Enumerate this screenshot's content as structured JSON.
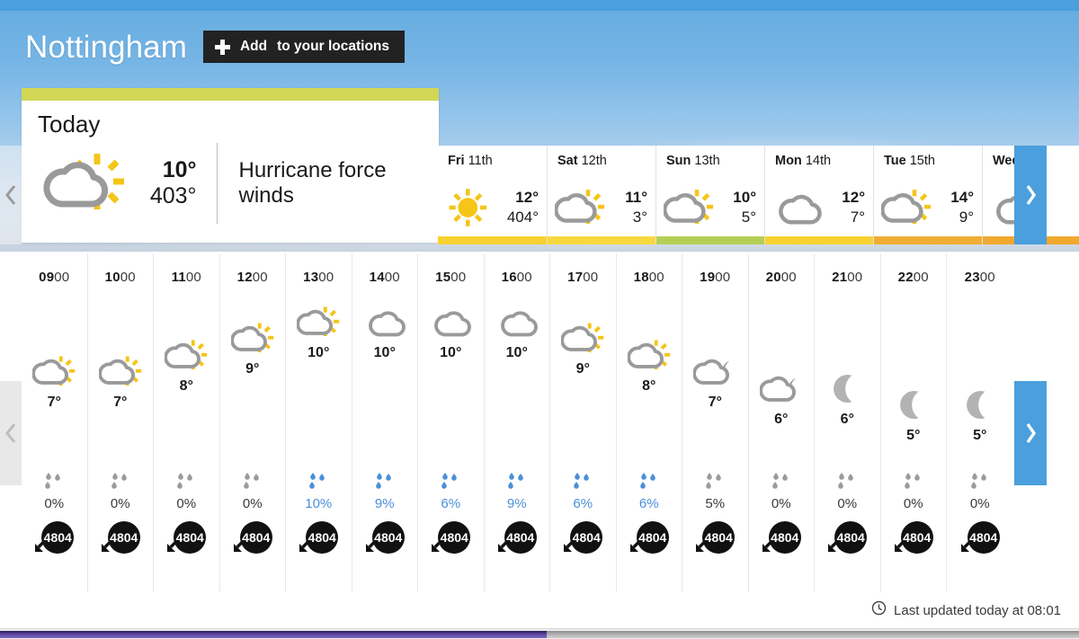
{
  "header": {
    "location": "Nottingham",
    "add_button": {
      "bold": "Add",
      "rest": "to your locations",
      "icon": "plus-icon"
    }
  },
  "today": {
    "label": "Today",
    "icon": "sun-behind-cloud-icon",
    "high": "10°",
    "low": "403°",
    "warning": "Hurricane force winds",
    "accent_color": "#d2d755"
  },
  "days": [
    {
      "day": "Fri",
      "date": "11th",
      "icon": "sun-icon",
      "high": "12°",
      "low": "404°",
      "accent": "#f7d232"
    },
    {
      "day": "Sat",
      "date": "12th",
      "icon": "sun-behind-cloud-icon",
      "high": "11°",
      "low": "3°",
      "accent": "#f7d83f"
    },
    {
      "day": "Sun",
      "date": "13th",
      "icon": "sun-behind-cloud-icon",
      "high": "10°",
      "low": "5°",
      "accent": "#b5cf54"
    },
    {
      "day": "Mon",
      "date": "14th",
      "icon": "cloud-icon",
      "high": "12°",
      "low": "7°",
      "accent": "#f7d232"
    },
    {
      "day": "Tue",
      "date": "15th",
      "icon": "sun-behind-cloud-icon",
      "high": "14°",
      "low": "9°",
      "accent": "#f0ad33"
    },
    {
      "day": "Wed",
      "date": "",
      "icon": "cloud-icon",
      "high": "",
      "low": "",
      "accent": "#f0a92e"
    }
  ],
  "hours": [
    {
      "hh": "09",
      "mm": "00",
      "icon": "sun-behind-cloud-icon",
      "temp": "7°",
      "level": 7,
      "precip": "0%",
      "precip_active": false,
      "wind": "4804",
      "wind_dir": "down-left"
    },
    {
      "hh": "10",
      "mm": "00",
      "icon": "sun-behind-cloud-icon",
      "temp": "7°",
      "level": 7,
      "precip": "0%",
      "precip_active": false,
      "wind": "4804",
      "wind_dir": "down-left"
    },
    {
      "hh": "11",
      "mm": "00",
      "icon": "sun-behind-cloud-icon",
      "temp": "8°",
      "level": 8,
      "precip": "0%",
      "precip_active": false,
      "wind": "4804",
      "wind_dir": "down-left"
    },
    {
      "hh": "12",
      "mm": "00",
      "icon": "sun-behind-cloud-icon",
      "temp": "9°",
      "level": 9,
      "precip": "0%",
      "precip_active": false,
      "wind": "4804",
      "wind_dir": "down-left"
    },
    {
      "hh": "13",
      "mm": "00",
      "icon": "sun-behind-cloud-icon",
      "temp": "10°",
      "level": 10,
      "precip": "10%",
      "precip_active": true,
      "wind": "4804",
      "wind_dir": "down-left"
    },
    {
      "hh": "14",
      "mm": "00",
      "icon": "cloud-icon",
      "temp": "10°",
      "level": 10,
      "precip": "9%",
      "precip_active": true,
      "wind": "4804",
      "wind_dir": "down-left"
    },
    {
      "hh": "15",
      "mm": "00",
      "icon": "cloud-icon",
      "temp": "10°",
      "level": 10,
      "precip": "6%",
      "precip_active": true,
      "wind": "4804",
      "wind_dir": "down-left"
    },
    {
      "hh": "16",
      "mm": "00",
      "icon": "cloud-icon",
      "temp": "10°",
      "level": 10,
      "precip": "9%",
      "precip_active": true,
      "wind": "4804",
      "wind_dir": "down-left"
    },
    {
      "hh": "17",
      "mm": "00",
      "icon": "sun-behind-cloud-icon",
      "temp": "9°",
      "level": 9,
      "precip": "6%",
      "precip_active": true,
      "wind": "4804",
      "wind_dir": "down-left"
    },
    {
      "hh": "18",
      "mm": "00",
      "icon": "sun-behind-cloud-icon",
      "temp": "8°",
      "level": 8,
      "precip": "6%",
      "precip_active": true,
      "wind": "4804",
      "wind_dir": "down-left"
    },
    {
      "hh": "19",
      "mm": "00",
      "icon": "moon-behind-cloud-icon",
      "temp": "7°",
      "level": 7,
      "precip": "5%",
      "precip_active": false,
      "wind": "4804",
      "wind_dir": "down-left"
    },
    {
      "hh": "20",
      "mm": "00",
      "icon": "moon-behind-cloud-icon",
      "temp": "6°",
      "level": 6,
      "precip": "0%",
      "precip_active": false,
      "wind": "4804",
      "wind_dir": "down-left"
    },
    {
      "hh": "21",
      "mm": "00",
      "icon": "moon-icon",
      "temp": "6°",
      "level": 6,
      "precip": "0%",
      "precip_active": false,
      "wind": "4804",
      "wind_dir": "down-left"
    },
    {
      "hh": "22",
      "mm": "00",
      "icon": "moon-icon",
      "temp": "5°",
      "level": 5,
      "precip": "0%",
      "precip_active": false,
      "wind": "4804",
      "wind_dir": "down-left"
    },
    {
      "hh": "23",
      "mm": "00",
      "icon": "moon-icon",
      "temp": "5°",
      "level": 5,
      "precip": "0%",
      "precip_active": false,
      "wind": "4804",
      "wind_dir": "down-left"
    }
  ],
  "nav": {
    "prev_days": "chevron-left-icon",
    "next_days": "chevron-right-icon",
    "prev_hours": "chevron-left-icon",
    "next_hours": "chevron-right-icon"
  },
  "footer": {
    "icon": "clock-icon",
    "text": "Last updated today at 08:01"
  },
  "colors": {
    "accent_blue": "#4a9fdc",
    "precip_active": "#4a90d9",
    "precip_inactive": "#9b9b9b",
    "icon_gray": "#9a9a9a",
    "icon_yellow": "#f5c518"
  }
}
